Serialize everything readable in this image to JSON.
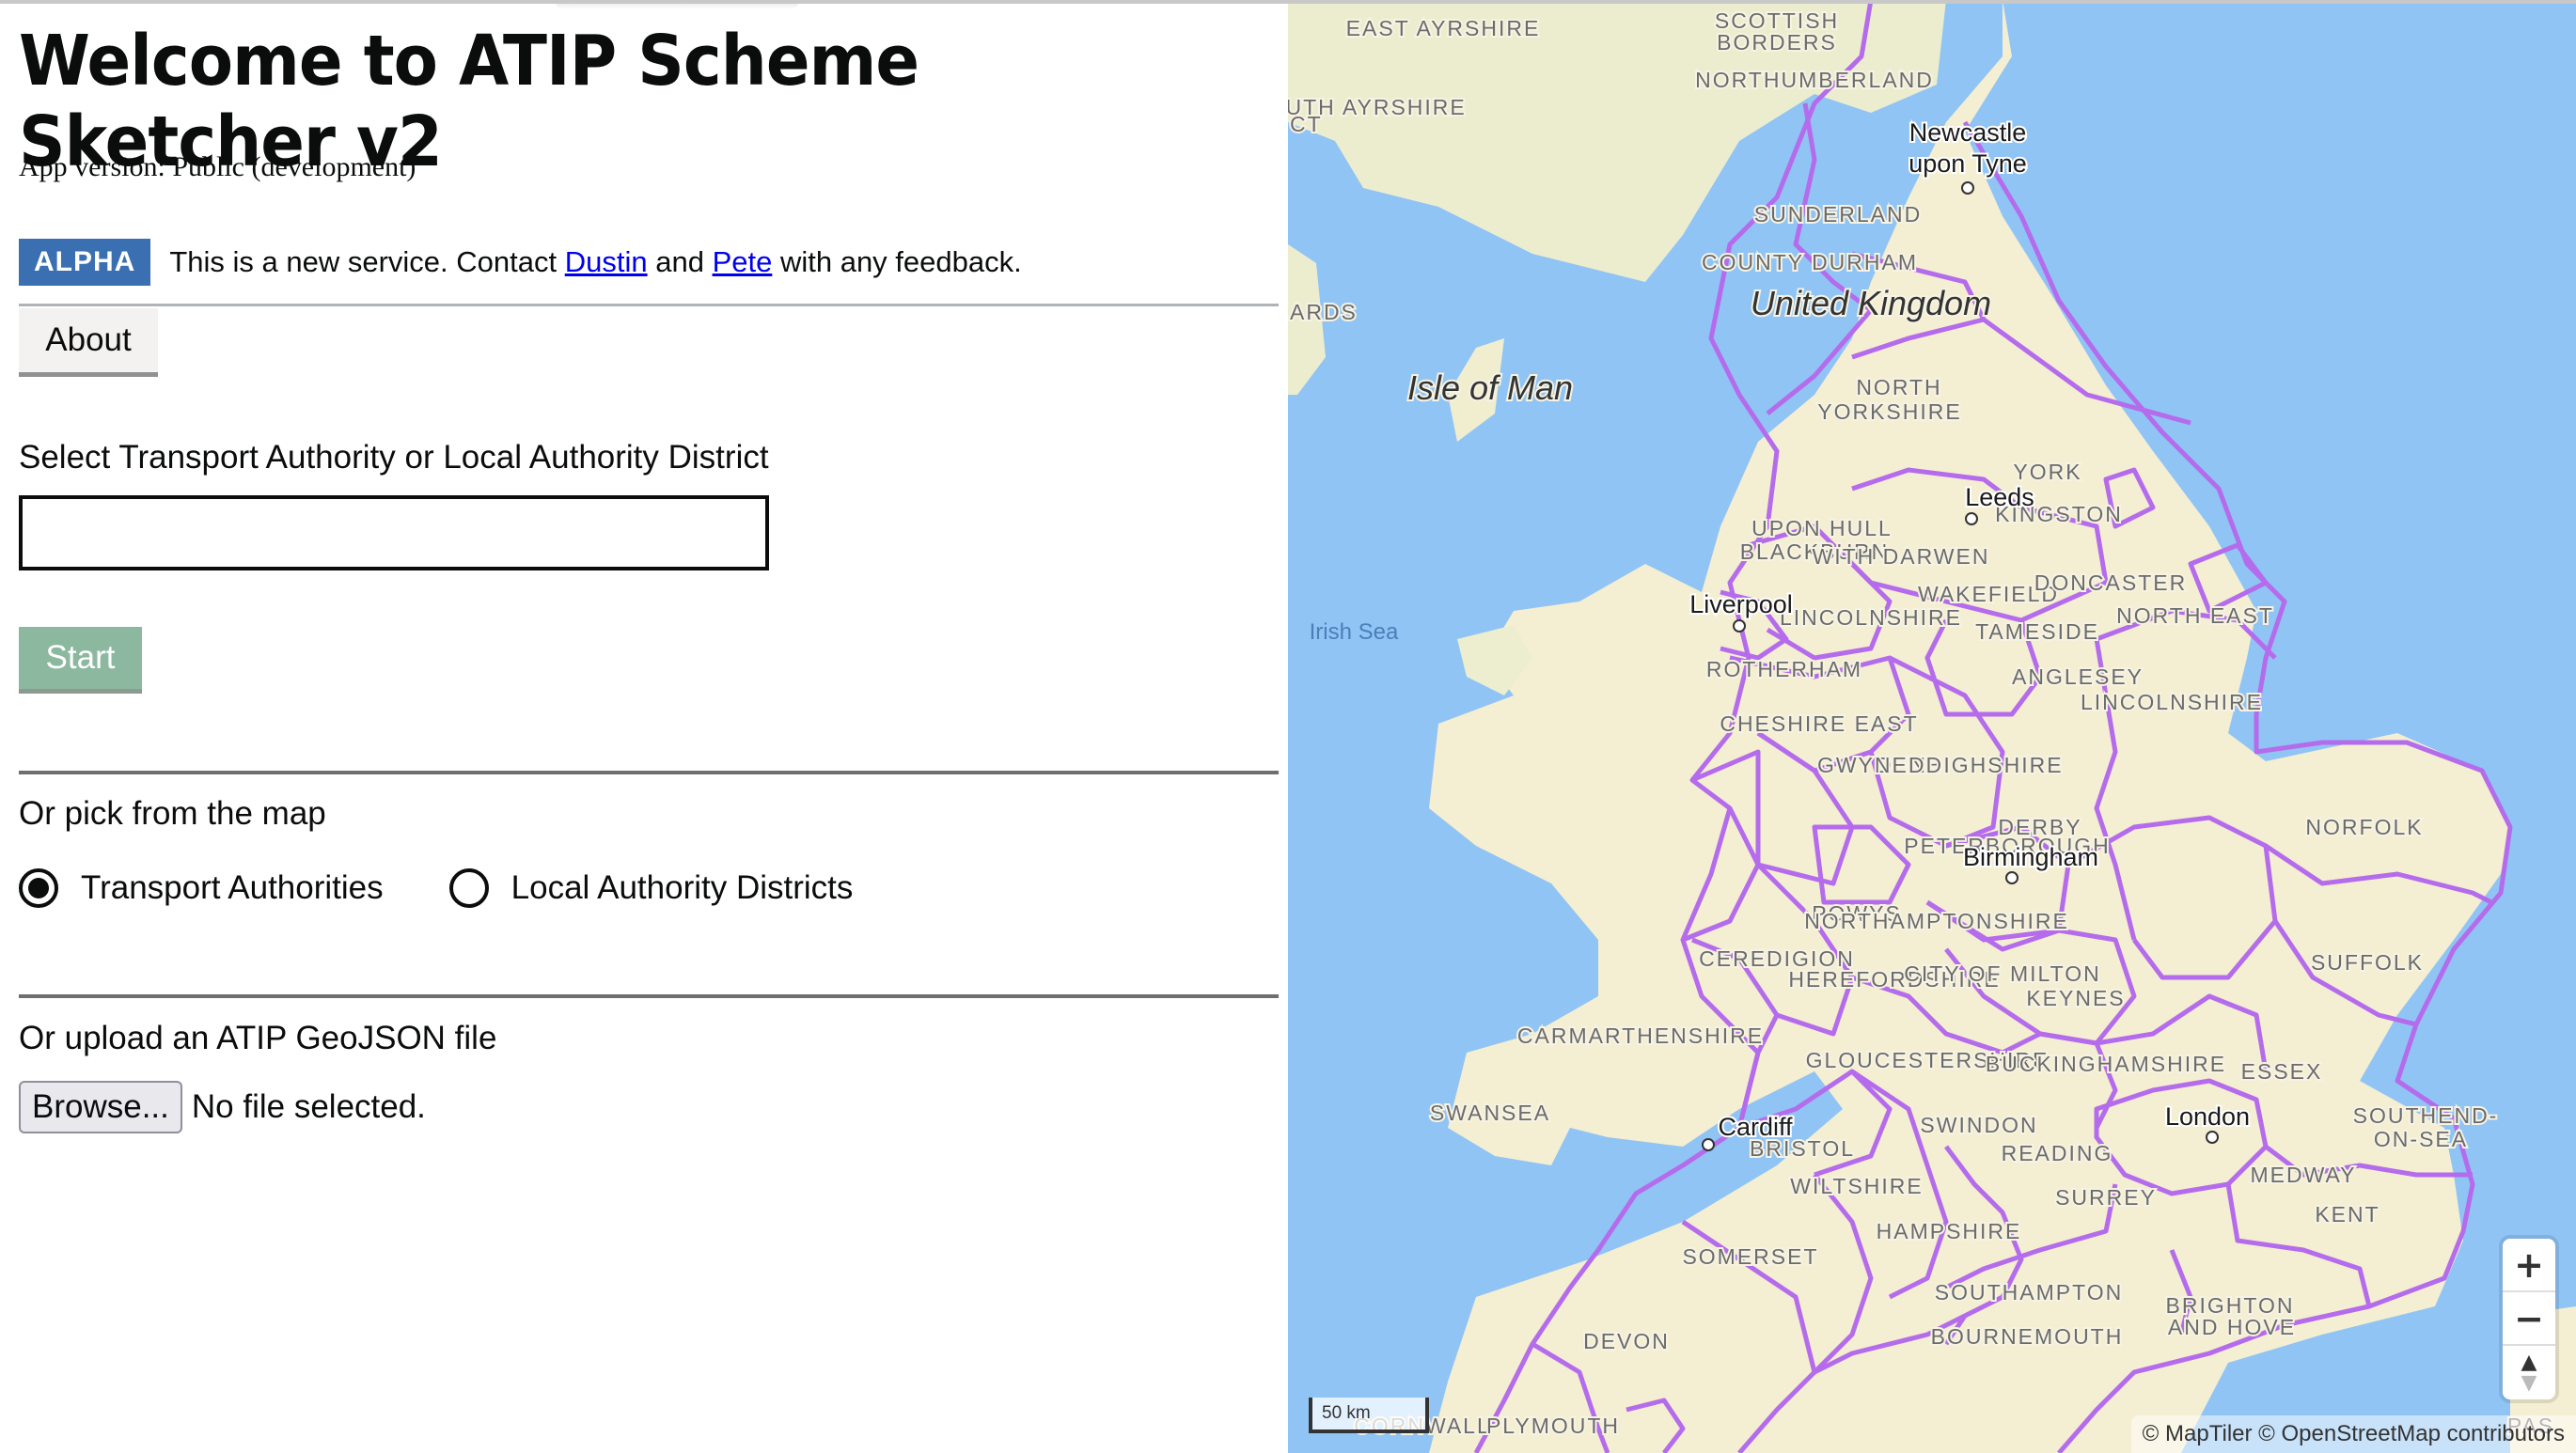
{
  "page": {
    "title": "Welcome to ATIP Scheme Sketcher v2",
    "app_version": "App version: Public (development)"
  },
  "banner": {
    "badge": "ALPHA",
    "text_before": "This is a new service. Contact ",
    "link1": "Dustin",
    "text_middle": " and ",
    "link2": "Pete",
    "text_after": " with any feedback."
  },
  "about_button": "About",
  "select": {
    "label": "Select Transport Authority or Local Authority District",
    "value": "",
    "placeholder": ""
  },
  "start_button": "Start",
  "pick_map": {
    "label": "Or pick from the map",
    "options": [
      {
        "label": "Transport Authorities",
        "selected": true
      },
      {
        "label": "Local Authority Districts",
        "selected": false
      }
    ]
  },
  "upload": {
    "label": "Or upload an ATIP GeoJSON file",
    "browse_button": "Browse...",
    "file_status": "No file selected."
  },
  "map": {
    "colors": {
      "sea": "#90c4f5",
      "land": "#f4eed2",
      "boundary": "#b56cec"
    },
    "labels": {
      "regions": [
        "EAST AYRSHIRE",
        "SCOTTISH",
        "BORDERS",
        "NORTHUMBERLAND",
        "SOUTH AYRSHIRE",
        "SUNDERLAND",
        "COUNTY DURHAM",
        "NORTH",
        "YORKSHIRE",
        "YORK",
        "KINGSTON",
        "UPON HULL",
        "BLACKBURN",
        "WITH DARWEN",
        "WAKEFIELD",
        "DONCASTER",
        "NORTH EAST",
        "LINCOLNSHIRE",
        "TAMESIDE",
        "ROTHERHAM",
        "ANGLESEY",
        "CHESHIRE EAST",
        "DENBIGHSHIRE",
        "LINCOLNSHIRE",
        "GWYNEDD",
        "DERBY",
        "NORFOLK",
        "PETERBOROUGH",
        "POWYS",
        "NORTHAMPTONSHIRE",
        "SUFFOLK",
        "CEREDIGION",
        "HEREFORDSHIRE",
        "CITY OF MILTON",
        "KEYNES",
        "CARMARTHENSHIRE",
        "GLOUCESTERSHIRE",
        "BUCKINGHAMSHIRE",
        "ESSEX",
        "SWANSEA",
        "SWINDON",
        "SOUTHEND-",
        "ON-SEA",
        "BRISTOL",
        "READING",
        "WILTSHIRE",
        "MEDWAY",
        "SURREY",
        "KENT",
        "HAMPSHIRE",
        "SOMERSET",
        "SOUTHAMPTON",
        "BRIGHTON",
        "AND HOVE",
        "DEVON",
        "BOURNEMOUTH",
        "CORNWALL",
        "PLYMOUTH",
        "PAS",
        "CT",
        "ARDS"
      ],
      "cities": [
        "Newcastle",
        "upon Tyne",
        "Leeds",
        "Liverpool",
        "Birmingham",
        "Cardiff",
        "London"
      ],
      "country": "United Kingdom",
      "islands": [
        "Isle of Man"
      ],
      "seas": [
        "Irish Sea"
      ]
    },
    "zoom_in": "+",
    "zoom_out": "−",
    "compass_up": "▲",
    "compass_down": "▼",
    "scale": "50 km",
    "attribution": "© MapTiler © OpenStreetMap contributors"
  }
}
